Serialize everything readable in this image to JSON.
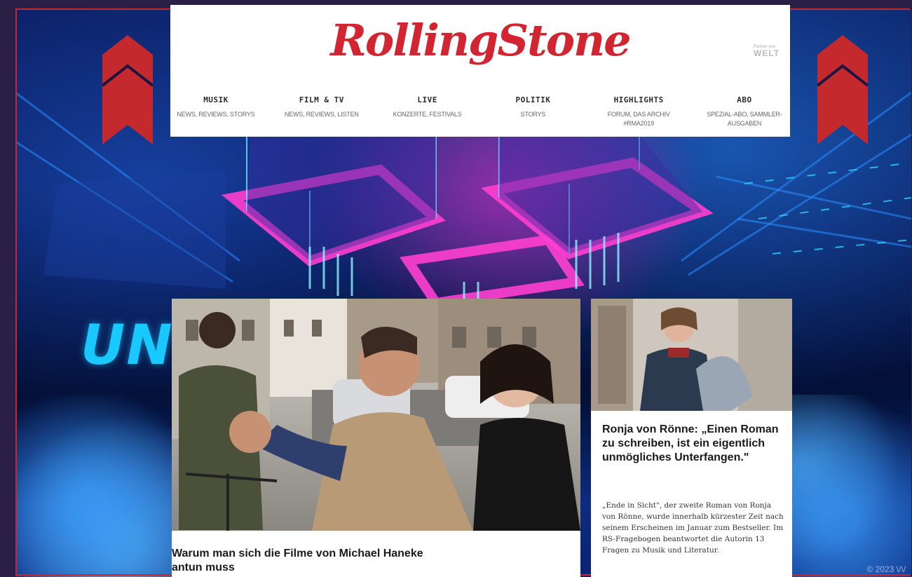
{
  "rs_header": {
    "logo": "RollingStone",
    "partner_label": "Partner von",
    "partner_brand": "WELT",
    "nav": [
      {
        "title": "MUSIK",
        "sub": "NEWS, REVIEWS, STORYS"
      },
      {
        "title": "FILM & TV",
        "sub": "NEWS, REVIEWS, LISTEN"
      },
      {
        "title": "LIVE",
        "sub": "KONZERTE, FESTIVALS"
      },
      {
        "title": "POLITIK",
        "sub": "STORYS"
      },
      {
        "title": "HIGHLIGHTS",
        "sub": "FORUM, DAS ARCHIV #RMA2019"
      },
      {
        "title": "ABO",
        "sub": "SPEZIAL-ABO, SAMMLER-AUSGABEN"
      }
    ]
  },
  "stage": {
    "logo_text": "UN",
    "copyright": "© 2023 \\/\\/"
  },
  "articles": {
    "main": {
      "headline": "Warum man sich die Filme von Michael Haneke antun muss"
    },
    "side": {
      "headline": "Ronja von Rönne: „Einen Roman zu schreiben, ist ein eigentlich unmögliches Unterfangen.\"",
      "body": "„Ende in Sicht\", der zweite Roman von Ronja von Rönne, wurde innerhalb kürzester Zeit nach seinem Erscheinen im Januar zum Bestseller. Im RS-Fragebogen beantwortet die Autorin 13 Fragen zu Musik und Literatur."
    }
  },
  "colors": {
    "rs_red": "#d32531",
    "marker_red": "#c4292d",
    "stage_blue": "#0a1a5c",
    "accent_cyan": "#19c8ff"
  }
}
